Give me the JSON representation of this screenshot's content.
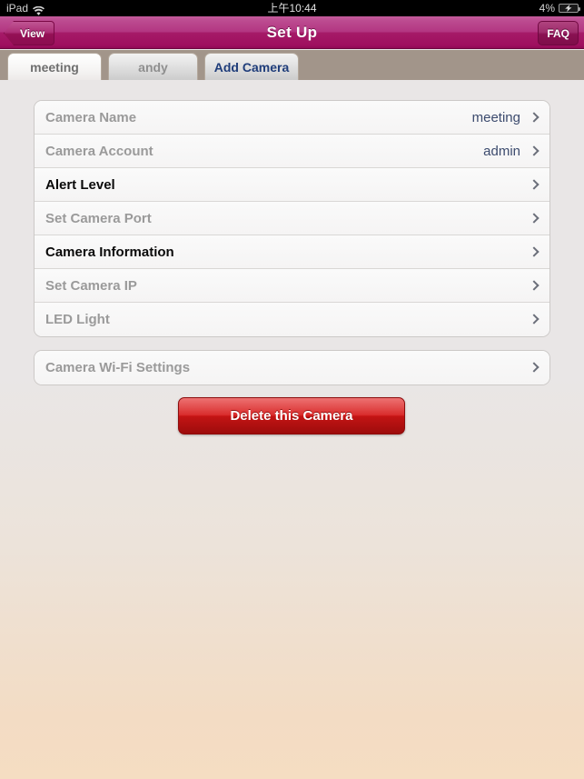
{
  "status_bar": {
    "device": "iPad",
    "wifi_icon": "wifi-icon",
    "time": "上午10:44",
    "battery_percent": "4%",
    "battery_icon": "battery-charging-icon"
  },
  "nav_bar": {
    "back_label": "View",
    "title": "Set Up",
    "faq_label": "FAQ",
    "accent_color": "#a61a68"
  },
  "tabs": [
    {
      "label": "meeting",
      "active": true,
      "style": "plain"
    },
    {
      "label": "andy",
      "active": false,
      "style": "plain"
    },
    {
      "label": "Add Camera",
      "active": false,
      "style": "accent"
    }
  ],
  "settings_list": [
    {
      "label": "Camera Name",
      "value": "meeting",
      "emphasis": "muted",
      "chevron": "chevron-right-icon"
    },
    {
      "label": "Camera Account",
      "value": "admin",
      "emphasis": "muted",
      "chevron": "chevron-right-icon"
    },
    {
      "label": "Alert Level",
      "value": "",
      "emphasis": "strong",
      "chevron": "chevron-right-icon"
    },
    {
      "label": "Set Camera Port",
      "value": "",
      "emphasis": "muted",
      "chevron": "chevron-right-icon"
    },
    {
      "label": "Camera Information",
      "value": "",
      "emphasis": "strong",
      "chevron": "chevron-right-icon"
    },
    {
      "label": "Set Camera IP",
      "value": "",
      "emphasis": "muted",
      "chevron": "chevron-right-icon"
    },
    {
      "label": "LED Light",
      "value": "",
      "emphasis": "muted",
      "chevron": "chevron-right-icon"
    }
  ],
  "wifi_list": [
    {
      "label": "Camera Wi-Fi Settings",
      "value": "",
      "emphasis": "muted",
      "chevron": "chevron-right-icon"
    }
  ],
  "delete_button": {
    "label": "Delete this Camera",
    "color": "#c41414"
  }
}
